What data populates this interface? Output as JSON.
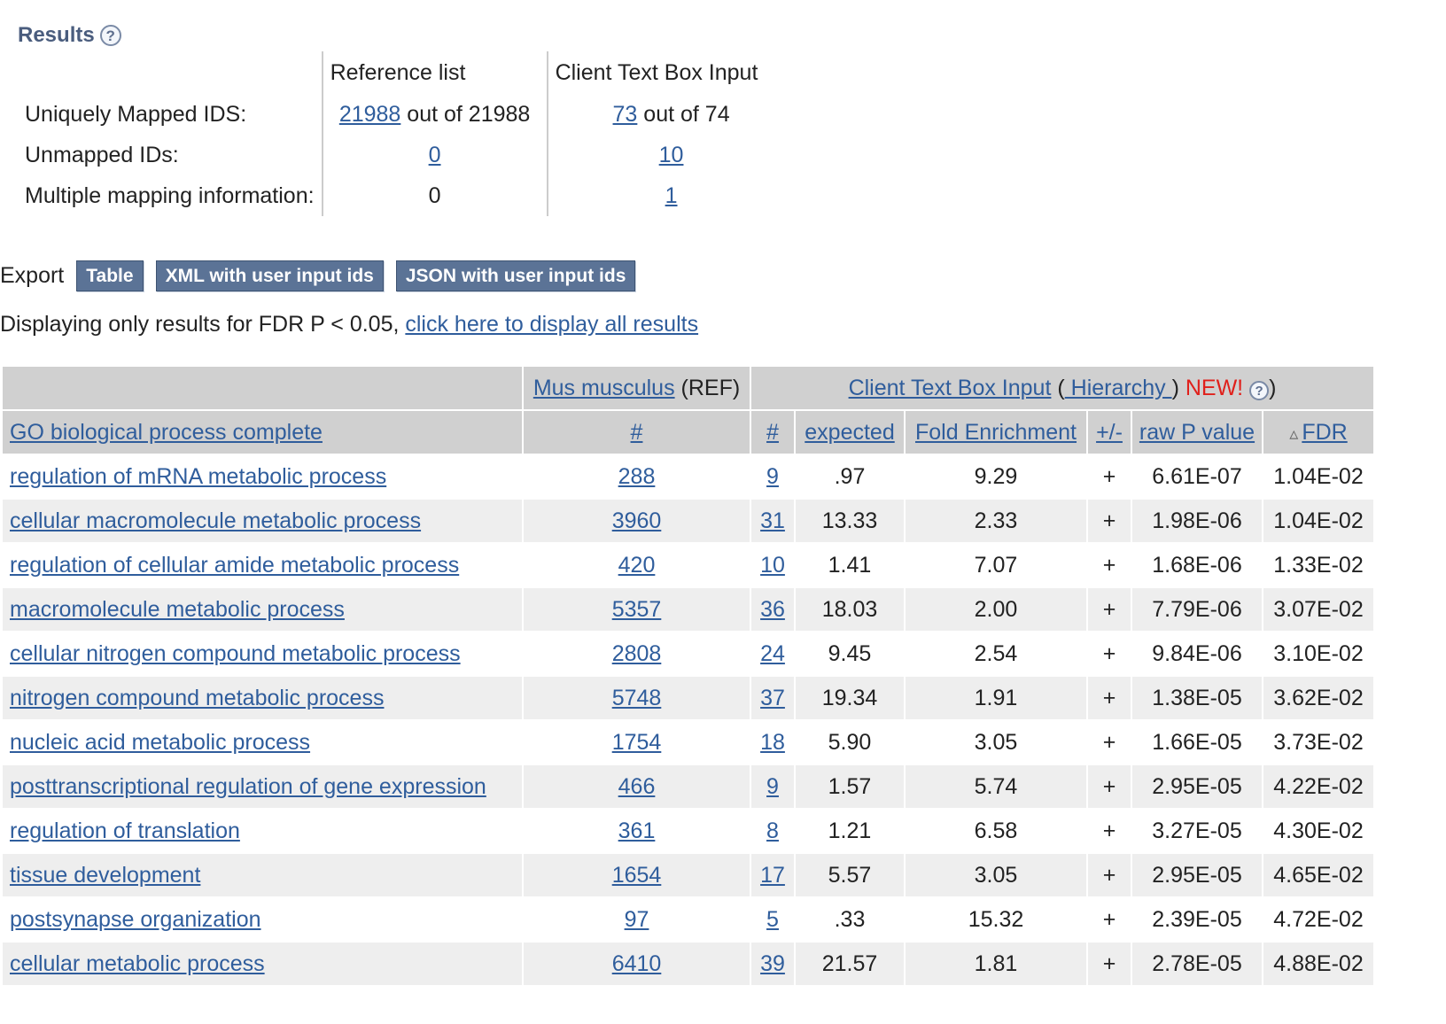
{
  "results": {
    "title": "Results",
    "help_symbol": "?"
  },
  "mapping": {
    "headers": {
      "reference": "Reference list",
      "input": "Client Text Box Input"
    },
    "rows": [
      {
        "label": "Uniquely Mapped IDS:",
        "ref_link": "21988",
        "ref_text": " out of 21988",
        "in_link": "73",
        "in_text": " out of 74"
      },
      {
        "label": "Unmapped IDs:",
        "ref_link": "0",
        "in_link": "10"
      },
      {
        "label": "Multiple mapping information:",
        "ref_text": "0",
        "in_link": "1"
      }
    ]
  },
  "export": {
    "label": "Export",
    "buttons": [
      "Table",
      "XML with user input ids",
      "JSON with user input ids"
    ]
  },
  "filter": {
    "text": "Displaying only results for FDR P < 0.05, ",
    "link": "click here to display all results"
  },
  "table": {
    "ref_group": {
      "link": "Mus musculus",
      "suffix": " (REF)"
    },
    "input_group": {
      "link": "Client Text Box Input",
      "open_paren": " (",
      "hierarchy": " Hierarchy ",
      "close_paren": ")",
      "new_label": " NEW!",
      "help_symbol": "?",
      "end_paren": ")"
    },
    "columns": {
      "term": "GO biological process complete",
      "ref_count": "#",
      "in_count": "#",
      "expected": "expected",
      "fold": "Fold Enrichment",
      "dir": "+/-",
      "raw_p": "raw P value",
      "fdr": "FDR",
      "fdr_sort_icon": "▵"
    },
    "rows": [
      {
        "term": "regulation of mRNA metabolic process",
        "ref": "288",
        "count": "9",
        "expected": ".97",
        "fold": "9.29",
        "dir": "+",
        "raw_p": "6.61E-07",
        "fdr": "1.04E-02"
      },
      {
        "term": "cellular macromolecule metabolic process",
        "ref": "3960",
        "count": "31",
        "expected": "13.33",
        "fold": "2.33",
        "dir": "+",
        "raw_p": "1.98E-06",
        "fdr": "1.04E-02"
      },
      {
        "term": "regulation of cellular amide metabolic process",
        "ref": "420",
        "count": "10",
        "expected": "1.41",
        "fold": "7.07",
        "dir": "+",
        "raw_p": "1.68E-06",
        "fdr": "1.33E-02"
      },
      {
        "term": "macromolecule metabolic process",
        "ref": "5357",
        "count": "36",
        "expected": "18.03",
        "fold": "2.00",
        "dir": "+",
        "raw_p": "7.79E-06",
        "fdr": "3.07E-02"
      },
      {
        "term": "cellular nitrogen compound metabolic process",
        "ref": "2808",
        "count": "24",
        "expected": "9.45",
        "fold": "2.54",
        "dir": "+",
        "raw_p": "9.84E-06",
        "fdr": "3.10E-02"
      },
      {
        "term": "nitrogen compound metabolic process",
        "ref": "5748",
        "count": "37",
        "expected": "19.34",
        "fold": "1.91",
        "dir": "+",
        "raw_p": "1.38E-05",
        "fdr": "3.62E-02"
      },
      {
        "term": "nucleic acid metabolic process",
        "ref": "1754",
        "count": "18",
        "expected": "5.90",
        "fold": "3.05",
        "dir": "+",
        "raw_p": "1.66E-05",
        "fdr": "3.73E-02"
      },
      {
        "term": "posttranscriptional regulation of gene expression",
        "ref": "466",
        "count": "9",
        "expected": "1.57",
        "fold": "5.74",
        "dir": "+",
        "raw_p": "2.95E-05",
        "fdr": "4.22E-02"
      },
      {
        "term": "regulation of translation",
        "ref": "361",
        "count": "8",
        "expected": "1.21",
        "fold": "6.58",
        "dir": "+",
        "raw_p": "3.27E-05",
        "fdr": "4.30E-02"
      },
      {
        "term": "tissue development",
        "ref": "1654",
        "count": "17",
        "expected": "5.57",
        "fold": "3.05",
        "dir": "+",
        "raw_p": "2.95E-05",
        "fdr": "4.65E-02"
      },
      {
        "term": "postsynapse organization",
        "ref": "97",
        "count": "5",
        "expected": ".33",
        "fold": "15.32",
        "dir": "+",
        "raw_p": "2.39E-05",
        "fdr": "4.72E-02"
      },
      {
        "term": "cellular metabolic process",
        "ref": "6410",
        "count": "39",
        "expected": "21.57",
        "fold": "1.81",
        "dir": "+",
        "raw_p": "2.78E-05",
        "fdr": "4.88E-02"
      }
    ]
  },
  "colors": {
    "link": "#2f5d9c",
    "header_bg": "#d0d0d0",
    "stripe_bg": "#eeeeee",
    "button_bg": "#5b7396",
    "new_badge": "#e0201b",
    "title": "#4a5d7e"
  }
}
